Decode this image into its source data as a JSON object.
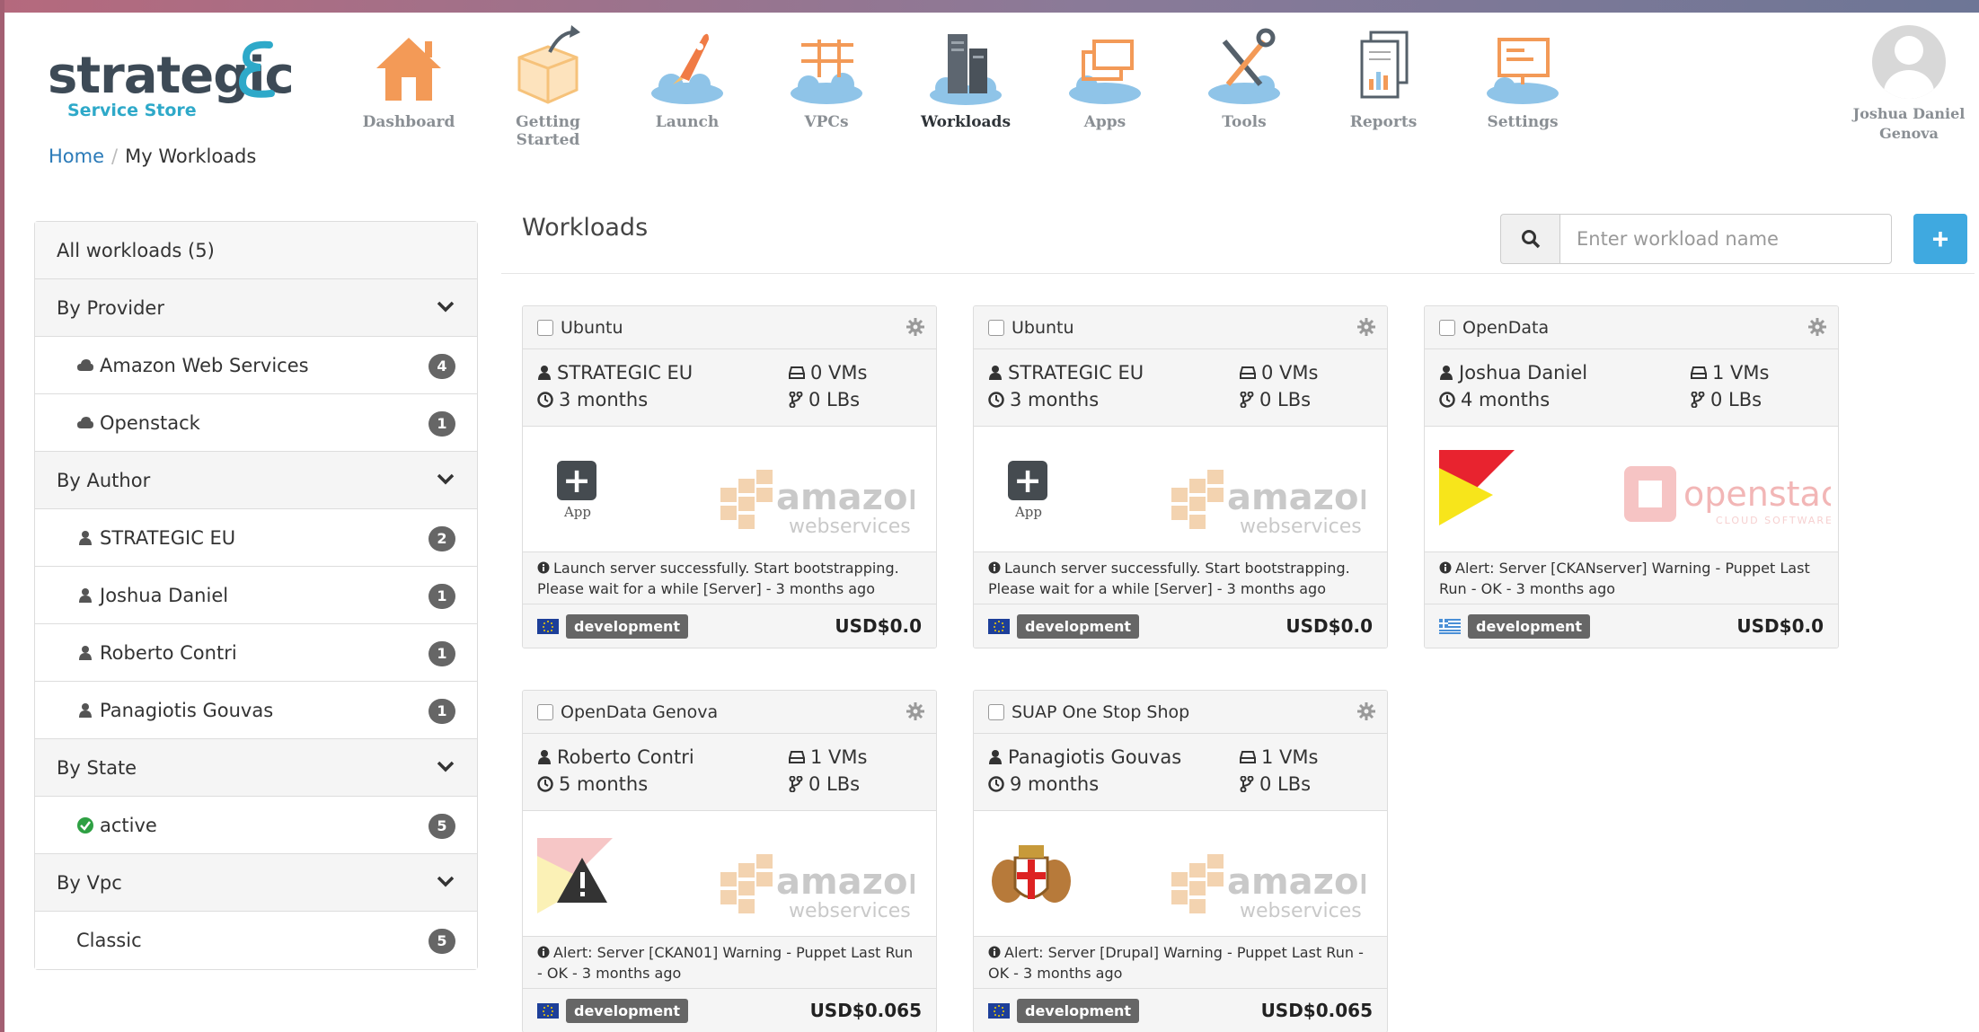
{
  "brand": {
    "name": "strategic",
    "sub": "Service Store"
  },
  "nav": [
    {
      "label": "Dashboard",
      "icon": "dashboard-icon"
    },
    {
      "label": "Getting Started",
      "icon": "getting-started-icon"
    },
    {
      "label": "Launch",
      "icon": "launch-icon"
    },
    {
      "label": "VPCs",
      "icon": "vpcs-icon"
    },
    {
      "label": "Workloads",
      "icon": "workloads-icon",
      "active": true
    },
    {
      "label": "Apps",
      "icon": "apps-icon"
    },
    {
      "label": "Tools",
      "icon": "tools-icon"
    },
    {
      "label": "Reports",
      "icon": "reports-icon"
    },
    {
      "label": "Settings",
      "icon": "settings-icon"
    }
  ],
  "user": {
    "name_line1": "Joshua Daniel",
    "name_line2": "Genova"
  },
  "breadcrumb": {
    "home": "Home",
    "current": "My Workloads"
  },
  "sidebar": {
    "all": "All workloads (5)",
    "provider": {
      "title": "By Provider",
      "items": [
        {
          "label": "Amazon Web Services",
          "count": "4"
        },
        {
          "label": "Openstack",
          "count": "1"
        }
      ]
    },
    "author": {
      "title": "By Author",
      "items": [
        {
          "label": "STRATEGIC EU",
          "count": "2"
        },
        {
          "label": "Joshua Daniel",
          "count": "1"
        },
        {
          "label": "Roberto Contri",
          "count": "1"
        },
        {
          "label": "Panagiotis Gouvas",
          "count": "1"
        }
      ]
    },
    "state": {
      "title": "By State",
      "items": [
        {
          "label": "active",
          "count": "5"
        }
      ]
    },
    "vpc": {
      "title": "By Vpc",
      "items": [
        {
          "label": "Classic",
          "count": "5"
        }
      ]
    }
  },
  "main": {
    "title": "Workloads",
    "search_placeholder": "Enter workload name",
    "add_label": "+"
  },
  "cards": [
    {
      "name": "Ubuntu",
      "author": "STRATEGIC EU",
      "age": "3 months",
      "vms": "0 VMs",
      "lbs": "0 LBs",
      "msg": "Launch server successfully. Start bootstrapping. Please wait for a while [Server] - 3 months ago",
      "env": "development",
      "price": "USD$0.0",
      "app_label": "App",
      "provider_logo_text": "amazon",
      "provider_logo_sub": "webservices"
    },
    {
      "name": "Ubuntu",
      "author": "STRATEGIC EU",
      "age": "3 months",
      "vms": "0 VMs",
      "lbs": "0 LBs",
      "msg": "Launch server successfully. Start bootstrapping. Please wait for a while [Server] - 3 months ago",
      "env": "development",
      "price": "USD$0.0",
      "app_label": "App",
      "provider_logo_text": "amazon",
      "provider_logo_sub": "webservices"
    },
    {
      "name": "OpenData",
      "author": "Joshua Daniel",
      "age": "4 months",
      "vms": "1 VMs",
      "lbs": "0 LBs",
      "msg": "Alert: Server [CKANserver] Warning - Puppet Last Run - OK - 3 months ago",
      "env": "development",
      "price": "USD$0.0",
      "provider_logo_text": "openstack",
      "provider_logo_sub": "CLOUD SOFTWARE"
    },
    {
      "name": "OpenData Genova",
      "author": "Roberto Contri",
      "age": "5 months",
      "vms": "1 VMs",
      "lbs": "0 LBs",
      "msg": "Alert: Server [CKAN01] Warning - Puppet Last Run - OK - 3 months ago",
      "env": "development",
      "price": "USD$0.065",
      "provider_logo_text": "amazon",
      "provider_logo_sub": "webservices"
    },
    {
      "name": "SUAP One Stop Shop",
      "author": "Panagiotis Gouvas",
      "age": "9 months",
      "vms": "1 VMs",
      "lbs": "0 LBs",
      "msg": "Alert: Server [Drupal] Warning - Puppet Last Run - OK - 3 months ago",
      "env": "development",
      "price": "USD$0.065",
      "provider_logo_text": "amazon",
      "provider_logo_sub": "webservices"
    }
  ],
  "colors": {
    "accent": "#3fa9e0",
    "nav_orange": "#f39a57",
    "cloud": "#8fc4e8",
    "badge": "#666666"
  }
}
